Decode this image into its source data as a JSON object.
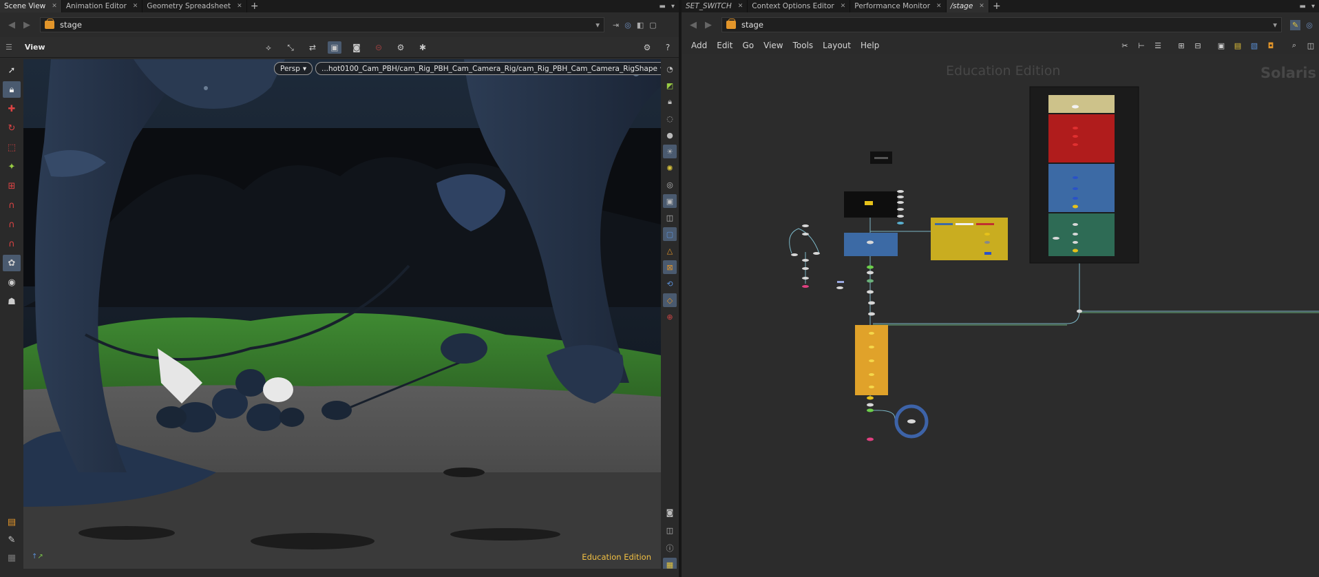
{
  "left_pane": {
    "tabs": [
      {
        "label": "Scene View",
        "active": true
      },
      {
        "label": "Animation Editor",
        "active": false
      },
      {
        "label": "Geometry Spreadsheet",
        "active": false
      }
    ],
    "path": "stage",
    "view_label": "View",
    "camera_menu": "Persp",
    "camera_path": "...hot0100_Cam_PBH/cam_Rig_PBH_Cam_Camera_Rig/cam_Rig_PBH_Cam_Camera_RigShape",
    "edition_label": "Education Edition"
  },
  "right_pane": {
    "tabs": [
      {
        "label": "SET_SWITCH",
        "active": false,
        "italic": true
      },
      {
        "label": "Context Options Editor",
        "active": false
      },
      {
        "label": "Performance Monitor",
        "active": false
      },
      {
        "label": "/stage",
        "active": true,
        "italic": true
      }
    ],
    "path": "stage",
    "menu": [
      "Add",
      "Edit",
      "Go",
      "View",
      "Tools",
      "Layout",
      "Help"
    ],
    "watermark_edition": "Education Edition",
    "watermark_context": "Solaris"
  },
  "colors": {
    "accent": "#4a5a6f",
    "education": "#f2c043",
    "network_box_red": "#b01c1c",
    "network_box_blue": "#3c6aa5",
    "network_box_green": "#2e6b55",
    "network_box_yellow": "#d5b423",
    "network_box_khaki": "#cdc28a"
  }
}
